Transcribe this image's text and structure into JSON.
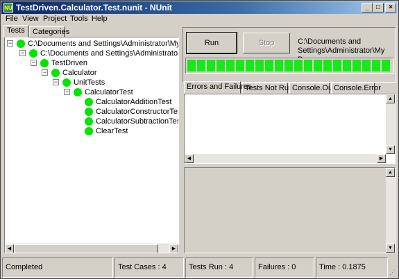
{
  "window": {
    "title": "TestDriven.Calculator.Test.nunit - NUnit",
    "icon_text": "NU"
  },
  "titlebar_buttons": {
    "minimize": "_",
    "maximize": "□",
    "close": "×"
  },
  "menu": [
    {
      "label": "File"
    },
    {
      "label": "View"
    },
    {
      "label": "Project"
    },
    {
      "label": "Tools"
    },
    {
      "label": "Help"
    }
  ],
  "left_tabs": [
    {
      "label": "Tests"
    },
    {
      "label": "Categories"
    }
  ],
  "tree": [
    {
      "label": "C:\\Documents and Settings\\Administrator\\My Docu",
      "expander": "−"
    },
    {
      "label": "C:\\Documents and Settings\\Administrator\\My Do",
      "expander": "−"
    },
    {
      "label": "TestDriven",
      "expander": "−"
    },
    {
      "label": "Calculator",
      "expander": "−"
    },
    {
      "label": "UnitTests",
      "expander": "−"
    },
    {
      "label": "CalculatorTest",
      "expander": "−"
    },
    {
      "label": "CalculatorAdditionTest",
      "expander": ""
    },
    {
      "label": "CalculatorConstructorTest",
      "expander": ""
    },
    {
      "label": "CalculatorSubtractionTest",
      "expander": ""
    },
    {
      "label": "ClearTest",
      "expander": ""
    }
  ],
  "status_color": "#00e600",
  "run_panel": {
    "run_label": "Run",
    "stop_label": "Stop",
    "path_line1": "C:\\Documents and",
    "path_line2": "Settings\\Administrator\\My Doc",
    "progress": 1.0,
    "progress_color": "#18e818"
  },
  "result_tabs": [
    {
      "label": "Errors and Failures"
    },
    {
      "label": "Tests Not Run"
    },
    {
      "label": "Console.Out"
    },
    {
      "label": "Console.Error"
    }
  ],
  "statusbar": {
    "status": "Completed",
    "test_cases": "Test Cases : 4",
    "tests_run": "Tests Run : 4",
    "failures": "Failures : 0",
    "time": "Time : 0.1875"
  }
}
